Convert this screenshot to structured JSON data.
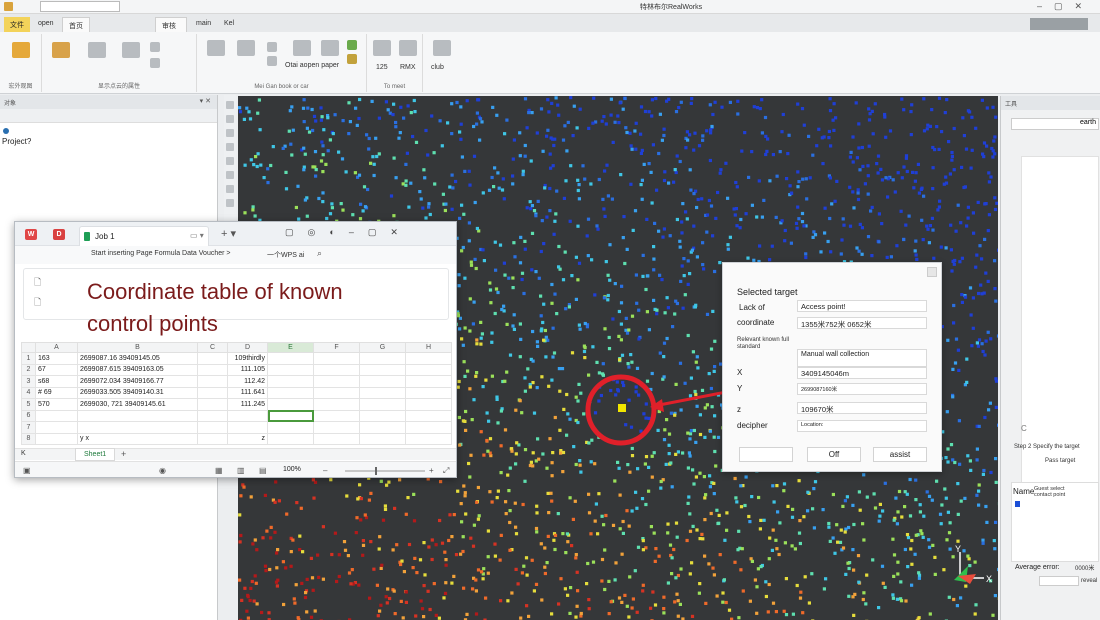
{
  "app_title": "特林布尔RealWorks",
  "menu_tabs": [
    "文件",
    "open",
    "首页",
    "",
    "审核",
    "main",
    "Kel"
  ],
  "ribbon": {
    "group_labels": [
      "宏外观图",
      "显示点云的属性",
      "Mei Gan book or car",
      "To meet"
    ],
    "tool_texts": [
      "Otai aopen paper",
      "125",
      "RMX",
      "club"
    ]
  },
  "left_panel": {
    "title": "对象",
    "project_label": "Project?"
  },
  "spreadsheet": {
    "tab_name": "Job 1",
    "toolbar_hint": "Start inserting Page Formula Data Voucher >",
    "wps_label": "一个WPS ai",
    "overlay_title_line1": "Coordinate table of known",
    "overlay_title_line2": "control points",
    "columns": [
      "A",
      "B",
      "C",
      "D",
      "E",
      "F",
      "G",
      "H"
    ],
    "active_column": "E",
    "rows": [
      {
        "n": "1",
        "a": "163",
        "b": "2699087.16 39409145.05",
        "d": "109thirdly"
      },
      {
        "n": "2",
        "a": "67",
        "b": "2699087.615 39409163.05",
        "d": "111.105"
      },
      {
        "n": "3",
        "a": "s68",
        "b": "2699072.034 39409166.77",
        "d": "112.42"
      },
      {
        "n": "4",
        "a": "# 69",
        "b": "2699033.505 39409140.31",
        "d": "111.641"
      },
      {
        "n": "5",
        "a": "570",
        "b": "2699030, 721 39409145.61",
        "d": "111.245"
      },
      {
        "n": "6",
        "a": "",
        "b": "",
        "d": ""
      },
      {
        "n": "7",
        "a": "",
        "b": "",
        "d": ""
      },
      {
        "n": "8",
        "a": "",
        "b": "y    x",
        "d": "z"
      }
    ],
    "sheet_letter": "K",
    "sheet_name": "Sheet1",
    "zoom": "100%"
  },
  "dialog": {
    "title": "Selected target",
    "lack_of_label": "Lack of",
    "lack_of_value": "Access point!",
    "coordinate_label": "coordinate",
    "coordinate_value": "1355米752米 0652米",
    "relevant_label": "Relevant known full standard",
    "manual_value": "Manual wall collection",
    "x_label": "X",
    "x_value": "3409145046m",
    "y_label": "Y",
    "y_value": "2699087160米",
    "z_label": "z",
    "z_value": "109670米",
    "decipher_label": "decipher",
    "location_label": "Location:",
    "off_button": "Off",
    "assist_button": "assist"
  },
  "right_panel": {
    "title": "工具",
    "earth": "earth",
    "c_mark": "C",
    "step2": "Step 2 Specify the target",
    "pass_target": "Pass target",
    "name_label": "Name",
    "guest": "Guest select contact point",
    "avg_error_label": "Average error:",
    "avg_error_value": "0000米",
    "reveal": "reveal"
  },
  "viewport": {
    "axis_labels": [
      "Y",
      "X"
    ]
  },
  "colors": {
    "accent_menu": "#f3d35a",
    "viewport_bg": "#353739",
    "annotation_red": "#e0202a",
    "overlay_text": "#7b1b1b"
  }
}
